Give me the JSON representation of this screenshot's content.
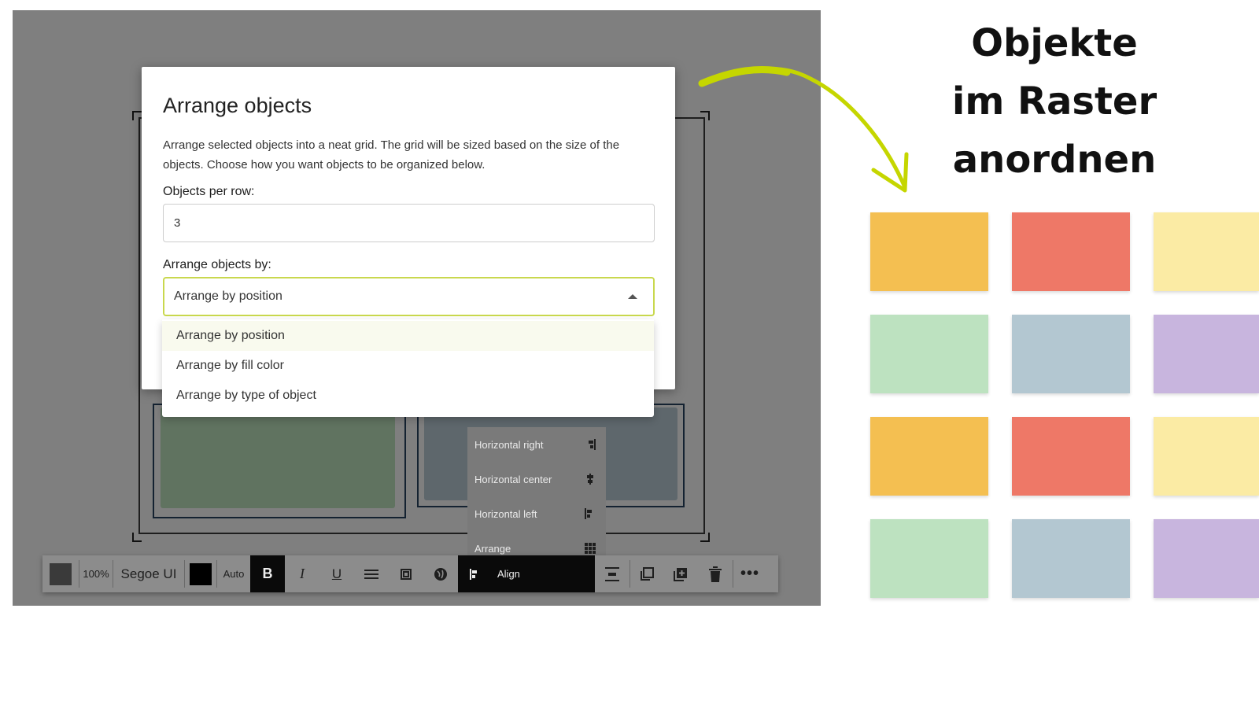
{
  "dialog": {
    "title": "Arrange objects",
    "description": "Arrange selected objects into a neat grid. The grid will be sized based on the size of the objects. Choose how you want objects to be organized below.",
    "objects_per_row_label": "Objects per row:",
    "objects_per_row_value": "3",
    "arrange_by_label": "Arrange objects by:",
    "arrange_by_selected": "Arrange by position",
    "options": [
      "Arrange by position",
      "Arrange by fill color",
      "Arrange by type of object"
    ]
  },
  "align_menu": {
    "items": [
      {
        "label": "Horizontal right",
        "icon": "align-right-icon"
      },
      {
        "label": "Horizontal center",
        "icon": "align-center-icon"
      },
      {
        "label": "Horizontal left",
        "icon": "align-left-icon"
      },
      {
        "label": "Arrange",
        "icon": "grid-icon"
      }
    ]
  },
  "toolbar": {
    "zoom": "100%",
    "font": "Segoe UI",
    "size": "Auto",
    "bold": "B",
    "italic": "I",
    "underline": "U",
    "align_label": "Align"
  },
  "headline": [
    "Objekte",
    "im Raster",
    "anordnen"
  ],
  "colors": {
    "accent_border": "#c9d84e",
    "arrow": "#c5d600",
    "notes": [
      "#f4bf51",
      "#ee7867",
      "#fbeba4",
      "#bde2c0",
      "#b3c7d1",
      "#c8b5de"
    ]
  }
}
